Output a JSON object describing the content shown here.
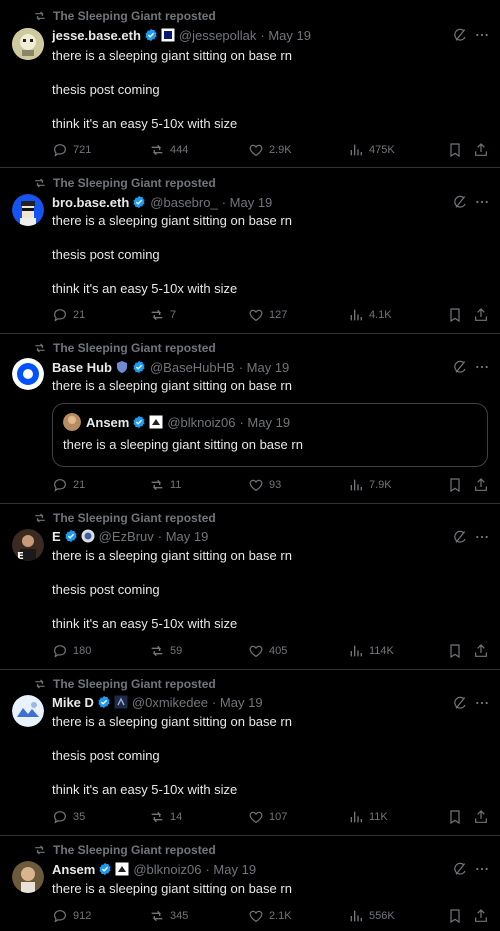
{
  "repost_label": "The Sleeping Giant reposted",
  "colors": {
    "verified": "#1d9bf0",
    "muted": "#71767b",
    "text": "#e7e9ea",
    "border": "#2f3336"
  },
  "posts": [
    {
      "name": "jesse.base.eth",
      "handle": "@jessepollak",
      "date": "· May 19",
      "line1": "there is a sleeping giant sitting on base rn",
      "line2": "thesis post coming",
      "line3": "think it's an easy 5-10x with size",
      "replies": "721",
      "reposts": "444",
      "likes": "2.9K",
      "views": "475K"
    },
    {
      "name": "bro.base.eth",
      "handle": "@basebro_",
      "date": "· May 19",
      "line1": "there is a sleeping giant sitting on base rn",
      "line2": "thesis post coming",
      "line3": "think it's an easy 5-10x with size",
      "replies": "21",
      "reposts": "7",
      "likes": "127",
      "views": "4.1K"
    },
    {
      "name": "Base Hub",
      "handle": "@BaseHubHB",
      "date": "· May 19",
      "line1": "there is a sleeping giant sitting on base rn",
      "quote": {
        "name": "Ansem",
        "handle": "@blknoiz06",
        "date": "· May 19",
        "text": "there is a sleeping giant sitting on base rn"
      },
      "replies": "21",
      "reposts": "11",
      "likes": "93",
      "views": "7.9K"
    },
    {
      "name": "E",
      "handle": "@EzBruv",
      "date": "· May 19",
      "line1": "there is a sleeping giant sitting on base rn",
      "line2": "thesis post coming",
      "line3": "think it's an easy 5-10x with size",
      "replies": "180",
      "reposts": "59",
      "likes": "405",
      "views": "114K"
    },
    {
      "name": "Mike D",
      "handle": "@0xmikedee",
      "date": "· May 19",
      "line1": "there is a sleeping giant sitting on base rn",
      "line2": "thesis post coming",
      "line3": "think it's an easy 5-10x with size",
      "replies": "35",
      "reposts": "14",
      "likes": "107",
      "views": "11K"
    },
    {
      "name": "Ansem",
      "handle": "@blknoiz06",
      "date": "· May 19",
      "line1": "there is a sleeping giant sitting on base rn",
      "replies": "912",
      "reposts": "345",
      "likes": "2.1K",
      "views": "556K"
    }
  ]
}
